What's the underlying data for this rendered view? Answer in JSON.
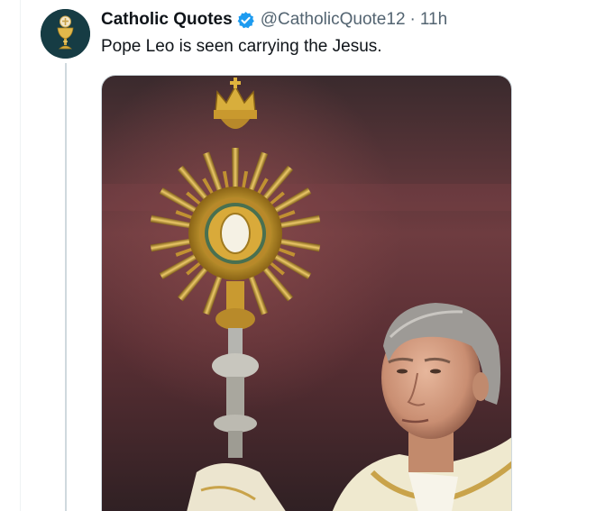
{
  "tweet": {
    "author": {
      "display_name": "Catholic Quotes",
      "verified": true,
      "handle": "@CatholicQuote12",
      "avatar_icon": "chalice-icon"
    },
    "separator": "·",
    "timestamp": "11h",
    "text": "Pope Leo is seen carrying the Jesus.",
    "media": {
      "type": "photo",
      "icon": "monstrance-photo"
    }
  },
  "colors": {
    "verified_badge": "#1d9bf0",
    "secondary_text": "#536471",
    "primary_text": "#0f1419",
    "thread_line": "#cfd9de"
  }
}
